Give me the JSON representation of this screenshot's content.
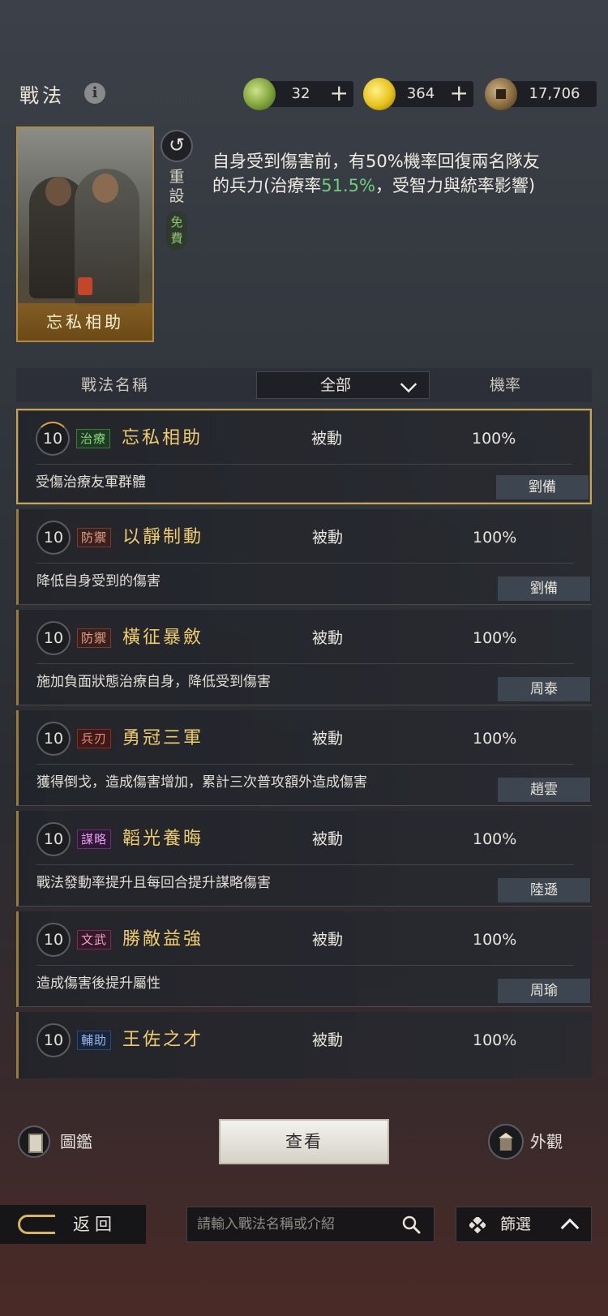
{
  "header": {
    "title": "戰法",
    "info_icon": "i",
    "resources": [
      {
        "name": "jade",
        "icon": "jade-coin-icon",
        "value": "32",
        "plus": "+"
      },
      {
        "name": "gold",
        "icon": "gold-coin-icon",
        "value": "364",
        "plus": "+"
      },
      {
        "name": "copper",
        "icon": "copper-coin-icon",
        "value": "17,706"
      }
    ]
  },
  "selected": {
    "card_name": "忘私相助",
    "reset_label": "重設",
    "free_label": "免費",
    "desc_before": "自身受到傷害前，有50%機率回復兩名隊友的兵力(治療率",
    "desc_highlight": "51.5%",
    "desc_after": "，受智力與統率影響)"
  },
  "table": {
    "col_name": "戰法名稱",
    "filter_value": "全部",
    "col_rate": "機率"
  },
  "skills": [
    {
      "level": "10",
      "tag": "治療",
      "name": "忘私相助",
      "type": "被動",
      "rate": "100%",
      "desc": "受傷治療友軍群體",
      "owner": "劉備"
    },
    {
      "level": "10",
      "tag": "防禦",
      "name": "以靜制動",
      "type": "被動",
      "rate": "100%",
      "desc": "降低自身受到的傷害",
      "owner": "劉備"
    },
    {
      "level": "10",
      "tag": "防禦",
      "name": "橫征暴斂",
      "type": "被動",
      "rate": "100%",
      "desc": "施加負面狀態治療自身，降低受到傷害",
      "owner": "周泰"
    },
    {
      "level": "10",
      "tag": "兵刃",
      "name": "勇冠三軍",
      "type": "被動",
      "rate": "100%",
      "desc": "獲得倒戈，造成傷害增加，累計三次普攻額外造成傷害",
      "owner": "趙雲"
    },
    {
      "level": "10",
      "tag": "謀略",
      "name": "韜光養晦",
      "type": "被動",
      "rate": "100%",
      "desc": "戰法發動率提升且每回合提升謀略傷害",
      "owner": "陸遜"
    },
    {
      "level": "10",
      "tag": "文武",
      "name": "勝敵益強",
      "type": "被動",
      "rate": "100%",
      "desc": "造成傷害後提升屬性",
      "owner": "周瑜"
    },
    {
      "level": "10",
      "tag": "輔助",
      "name": "王佐之才",
      "type": "被動",
      "rate": "100%",
      "desc": "",
      "owner": ""
    }
  ],
  "actions": {
    "encyclopedia": "圖鑑",
    "view": "查看",
    "appearance": "外觀"
  },
  "footer": {
    "back": "返回",
    "search_placeholder": "請輸入戰法名稱或介紹",
    "filter": "篩選"
  },
  "colors": {
    "highlight_green": "#6ecf7a",
    "skill_name_gold": "#f0cd6c",
    "selected_border": "#c9a454"
  }
}
